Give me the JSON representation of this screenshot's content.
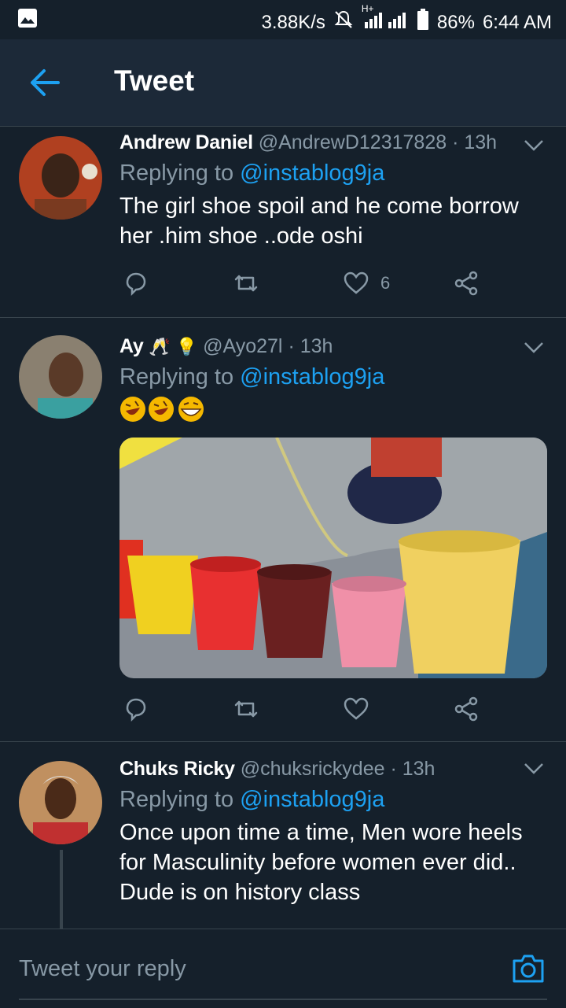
{
  "status_bar": {
    "speed": "3.88K/s",
    "network": "H+",
    "battery": "86%",
    "time": "6:44 AM"
  },
  "app_bar": {
    "title": "Tweet"
  },
  "tweets": [
    {
      "name": "Andrew Daniel",
      "handle": "@AndrewD12317828",
      "time": "· 13h",
      "replying_prefix": "Replying to ",
      "replying_to": "@instablog9ja",
      "text": "The girl shoe spoil and he come borrow her .him shoe ..ode oshi",
      "likes": "6"
    },
    {
      "name": "Ay",
      "name_emojis": [
        "clinking-glasses",
        "light-bulb"
      ],
      "handle": "@Ayo27l",
      "time": "· 13h",
      "replying_prefix": "Replying to ",
      "replying_to": "@instablog9ja",
      "text_emojis": [
        "rolling-on-floor-laughing",
        "rolling-on-floor-laughing",
        "grinning-squinting-face"
      ],
      "media": "photo-buckets-pouring-water"
    },
    {
      "name": "Chuks Ricky",
      "handle": "@chuksrickydee",
      "time": "· 13h",
      "replying_prefix": "Replying to ",
      "replying_to": "@instablog9ja",
      "text": "Once upon time a time, Men wore heels for Masculinity before women ever did.. Dude is on history class"
    }
  ],
  "composer": {
    "placeholder": "Tweet your reply"
  },
  "colors": {
    "background": "#15202b",
    "accent": "#1da1f2",
    "muted": "#8899a6",
    "divider": "#38444d"
  }
}
